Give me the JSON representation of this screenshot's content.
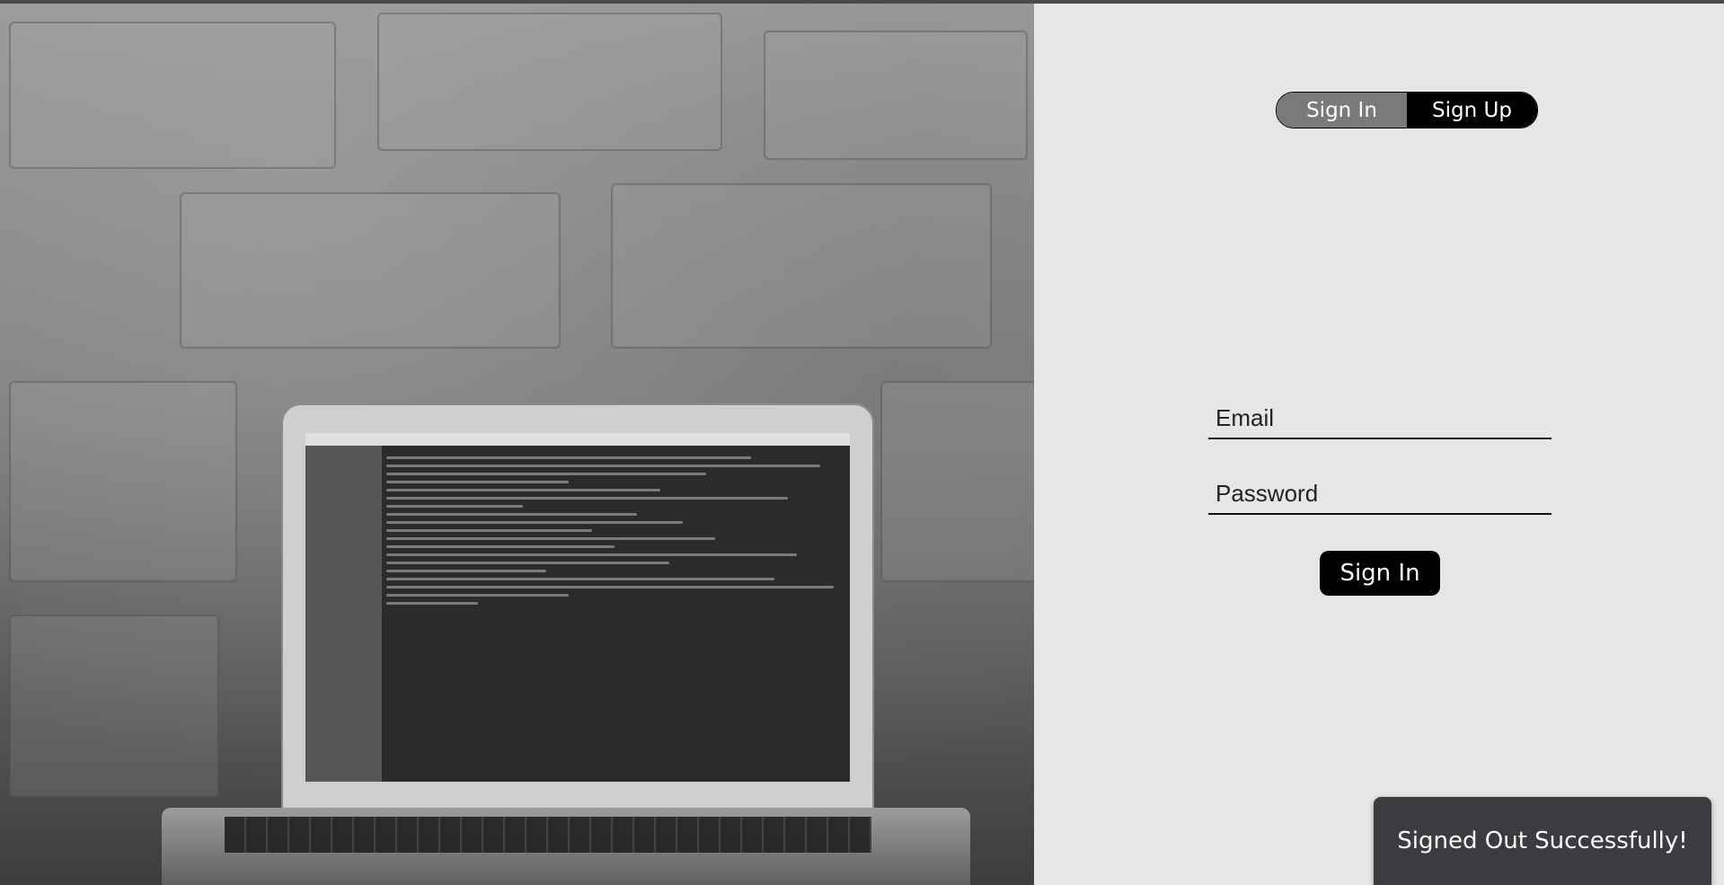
{
  "auth_toggle": {
    "sign_in_label": "Sign In",
    "sign_up_label": "Sign Up",
    "active": "Sign In"
  },
  "form": {
    "email_placeholder": "Email",
    "email_value": "",
    "password_placeholder": "Password",
    "password_value": "",
    "submit_label": "Sign In"
  },
  "toast": {
    "message": "Signed Out Successfully!"
  },
  "colors": {
    "panel_bg": "#e6e6e6",
    "toggle_active": "#7a7a7a",
    "toggle_inactive": "#000000",
    "button_bg": "#000000",
    "toast_bg": "#3d3b40"
  }
}
